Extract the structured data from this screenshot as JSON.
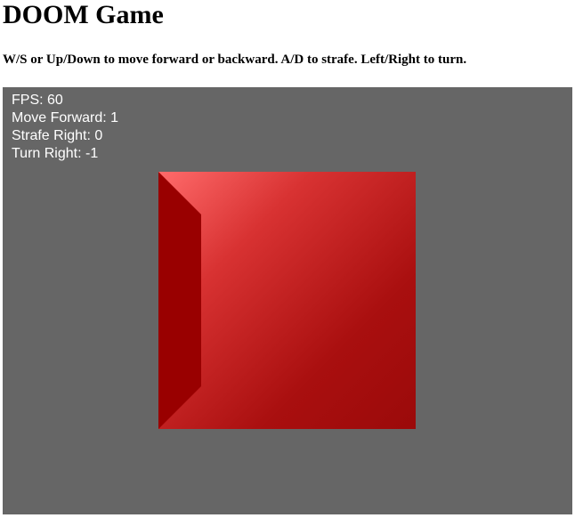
{
  "page": {
    "title": "DOOM Game",
    "instructions": "W/S or Up/Down to move forward or backward. A/D to strafe. Left/Right to turn."
  },
  "hud": {
    "fps_label": "FPS",
    "fps_value": "60",
    "move_forward_label": "Move Forward",
    "move_forward_value": "1",
    "strafe_right_label": "Strafe Right",
    "strafe_right_value": "0",
    "turn_right_label": "Turn Right",
    "turn_right_value": "-1"
  },
  "colors": {
    "viewport_background": "#666666",
    "wall_front_light": "#ff6b6b",
    "wall_front_dark": "#9b0a0a",
    "wall_side": "#990000",
    "hud_text": "#ffffff"
  }
}
